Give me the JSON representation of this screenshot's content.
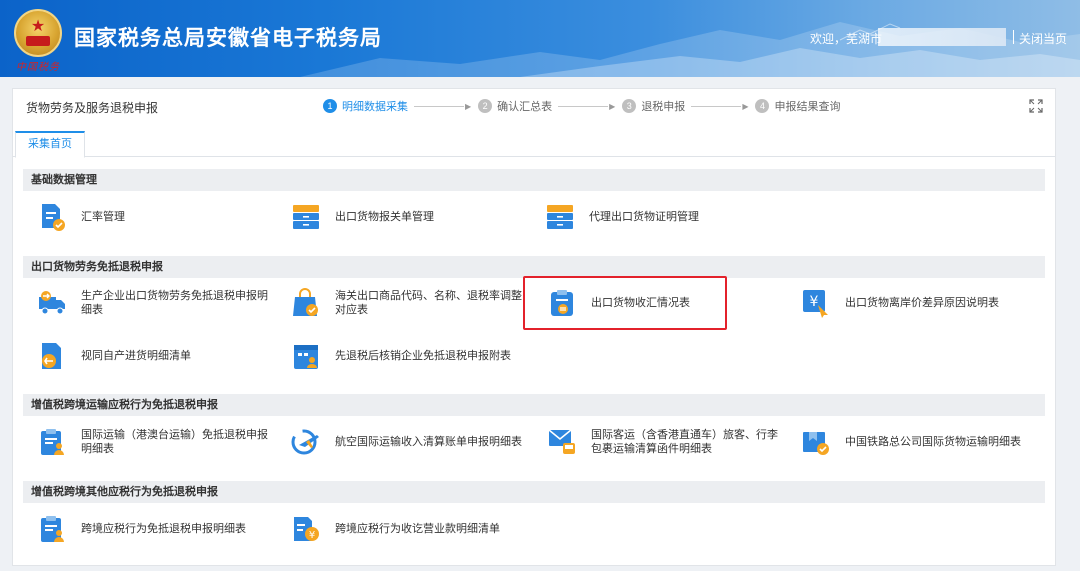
{
  "header": {
    "site_title": "国家税务总局安徽省电子税务局",
    "emblem_signature": "中国税务",
    "welcome": "欢迎，芜湖市",
    "close_page": "关闭当页"
  },
  "page": {
    "title": "货物劳务及服务退税申报",
    "steps": [
      {
        "num": "1",
        "label": "明细数据采集",
        "active": true
      },
      {
        "num": "2",
        "label": "确认汇总表",
        "active": false
      },
      {
        "num": "3",
        "label": "退税申报",
        "active": false
      },
      {
        "num": "4",
        "label": "申报结果查询",
        "active": false
      }
    ],
    "tab": "采集首页"
  },
  "sections": [
    {
      "title": "基础数据管理",
      "items": [
        {
          "label": "汇率管理",
          "icon": "exchange-rate-doc-icon"
        },
        {
          "label": "出口货物报关单管理",
          "icon": "drawer-cabinet-icon"
        },
        {
          "label": "代理出口货物证明管理",
          "icon": "drawer-cabinet-icon"
        }
      ]
    },
    {
      "title": "出口货物劳务免抵退税申报",
      "items": [
        {
          "label": "生产企业出口货物劳务免抵退税申报明细表",
          "icon": "delivery-truck-icon"
        },
        {
          "label": "海关出口商品代码、名称、退税率调整对应表",
          "icon": "shopping-bag-check-icon"
        },
        {
          "label": "出口货物收汇情况表",
          "icon": "clipboard-exchange-icon"
        },
        {
          "label": "出口货物离岸价差异原因说明表",
          "icon": "yuan-cursor-icon"
        },
        {
          "label": "视同自产进货明细清单",
          "icon": "doc-arrow-icon"
        },
        {
          "label": "先退税后核销企业免抵退税申报附表",
          "icon": "calendar-user-icon"
        }
      ]
    },
    {
      "title": "增值税跨境运输应税行为免抵退税申报",
      "items": [
        {
          "label": "国际运输（港澳台运输）免抵退税申报明细表",
          "icon": "clipboard-user-icon"
        },
        {
          "label": "航空国际运输收入清算账单申报明细表",
          "icon": "airplane-icon"
        },
        {
          "label": "国际客运（含香港直通车）旅客、行李包裹运输清算函件明细表",
          "icon": "mail-bus-icon"
        },
        {
          "label": "中国铁路总公司国际货物运输明细表",
          "icon": "bookmark-check-icon"
        }
      ]
    },
    {
      "title": "增值税跨境其他应税行为免抵退税申报",
      "items": [
        {
          "label": "跨境应税行为免抵退税申报明细表",
          "icon": "clipboard-user-icon"
        },
        {
          "label": "跨境应税行为收讫营业款明细清单",
          "icon": "doc-yuan-icon"
        }
      ]
    }
  ],
  "colors": {
    "accent": "#1f8ee8",
    "highlight": "#e3212b",
    "icon_blue": "#2e86de",
    "icon_orange": "#f5a623"
  }
}
